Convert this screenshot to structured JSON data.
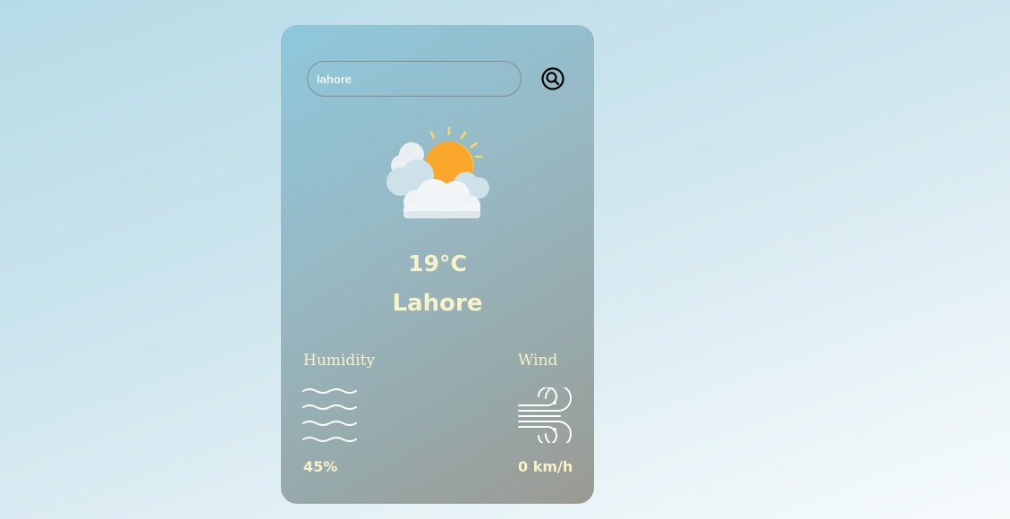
{
  "search": {
    "value": "lahore",
    "placeholder": ""
  },
  "weather": {
    "icon": "partly-cloudy-icon",
    "temperature": "19°C",
    "city": "Lahore"
  },
  "details": {
    "humidity": {
      "label": "Humidity",
      "value": "45%",
      "icon": "humidity-waves-icon"
    },
    "wind": {
      "label": "Wind",
      "value": "0 km/h",
      "icon": "wind-icon"
    }
  },
  "colors": {
    "text_accent": "#f7f2c8",
    "sun": "#f8a72b",
    "cloud": "#f2f5f7"
  }
}
